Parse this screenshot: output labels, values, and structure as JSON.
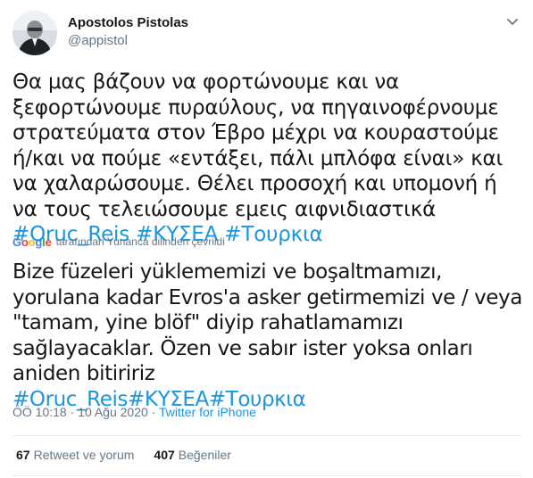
{
  "user": {
    "display_name": "Apostolos Pistolas",
    "handle": "@appistol"
  },
  "tweet": {
    "text_greek": "Θα μας βάζουν να φορτώνουμε και να ξεφορτώνουμε πυραύλους, να πηγαινοφέρνουμε στρατεύματα στον Έβρο μέχρι να κουραστούμε ή/και να πούμε «εντάξει, πάλι μπλόφα είναι» και να χαλαρώσουμε. Θέλει προσοχή και υπομονή ή να τους τελειώσουμε εμεις αιφνιδιαστικά",
    "hashtags_greek": [
      "#Oruc_Reis",
      "#ΚΥΣΕΑ",
      "#Τουρκια"
    ],
    "translation_label": "tarafından Yunanca dilinden çevrildi",
    "google_label": "Google",
    "text_translated": "Bize füzeleri yüklememizi ve boşaltmamızı, yorulana kadar Evros'a asker getirmemizi ve / veya \"tamam, yine blöf\" diyip rahatlamamızı sağlayacaklar. Özen ve sabır ister yoksa onları aniden bitiririz",
    "hashtags_translated": [
      "#Oruc_Reis",
      "#ΚΥΣΕΑ",
      "#Τουρκια"
    ],
    "time": "ÖÖ 10:18",
    "separator": "·",
    "date": "10 Ağu 2020",
    "source": "Twitter for iPhone"
  },
  "stats": {
    "retweets_count": "67",
    "retweets_label": "Retweet ve yorum",
    "likes_count": "407",
    "likes_label": "Beğeniler"
  },
  "colors": {
    "link": "#1b95e0",
    "secondary_text": "#657786",
    "divider": "#e6ecf0"
  },
  "icons": [
    "chevron-down-icon"
  ]
}
